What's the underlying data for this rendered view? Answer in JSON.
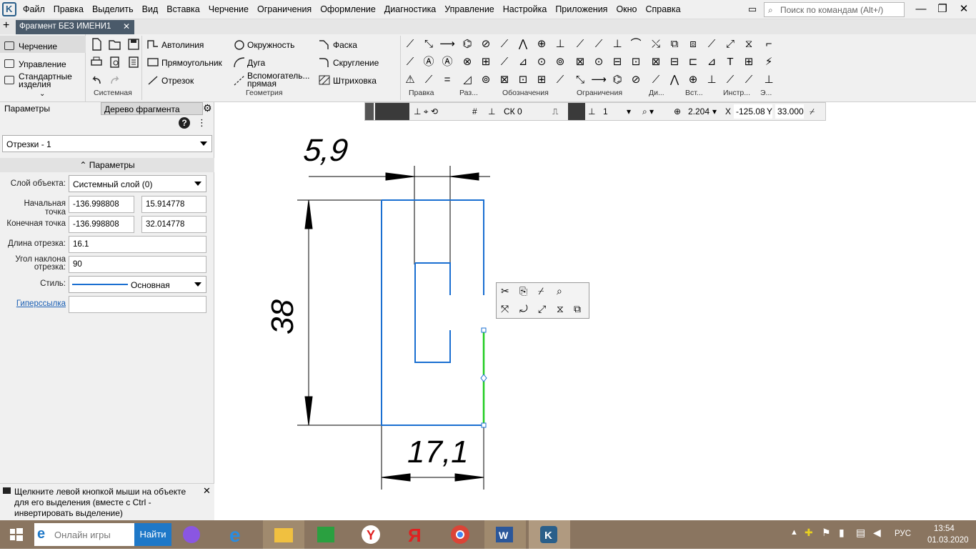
{
  "app": {
    "menu": [
      "Файл",
      "Правка",
      "Выделить",
      "Вид",
      "Вставка",
      "Черчение",
      "Ограничения",
      "Оформление",
      "Диагностика",
      "Управление",
      "Настройка",
      "Приложения",
      "Окно",
      "Справка"
    ],
    "search_placeholder": "Поиск по командам (Alt+/)",
    "document_tab": "Фрагмент БЕЗ ИМЕНИ1"
  },
  "nav": {
    "items": [
      "Черчение",
      "Управление",
      "Стандартные изделия"
    ]
  },
  "ribbon": {
    "geometry_buttons": {
      "autoline": "Автолиния",
      "circle": "Окружность",
      "chamfer": "Фаска",
      "rectangle": "Прямоугольник",
      "arc": "Дуга",
      "fillet": "Скругление",
      "segment": "Отрезок",
      "auxline": "Вспомогатель... прямая",
      "hatch": "Штриховка"
    },
    "groups": [
      "Системная",
      "Геометрия",
      "Правка",
      "Раз...",
      "Обозначения",
      "Ограничения",
      "Ди...",
      "Вст...",
      "Инстр...",
      "Э..."
    ]
  },
  "panel": {
    "tabs": [
      "Параметры",
      "Дерево фрагмента"
    ],
    "object_select": "Отрезки - 1",
    "section_title": "Параметры",
    "layer_label": "Слой объекта:",
    "layer_value": "Системный слой (0)",
    "start_label": "Начальная точка",
    "start_x": "-136.998808",
    "start_y": "15.914778",
    "end_label": "Конечная точка",
    "end_x": "-136.998808",
    "end_y": "32.014778",
    "length_label": "Длина отрезка:",
    "length_value": "16.1",
    "angle_label": "Угол наклона отрезка:",
    "angle_value": "90",
    "style_label": "Стиль:",
    "style_value": "Основная",
    "hyperlink_label": "Гиперссылка",
    "hint": "Щелкните левой кнопкой мыши на объекте для его выделения (вместе с Ctrl - инвертировать выделение)"
  },
  "canvas_toolbar": {
    "cs": "СК 0",
    "step": "1",
    "zoom": "2.204",
    "x_label": "X",
    "x_value": "-125.08",
    "y_label": "Y",
    "y_value": "33.000"
  },
  "drawing": {
    "dim_top": "5,9",
    "dim_left": "38",
    "dim_bottom": "17,1",
    "colors": {
      "contour": "#1a6fd1",
      "selected": "#22cc22",
      "dimension": "#000000"
    }
  },
  "taskbar": {
    "search_text": "Онлайн игры",
    "search_button": "Найти",
    "language": "РУС",
    "time": "13:54",
    "date": "01.03.2020"
  }
}
